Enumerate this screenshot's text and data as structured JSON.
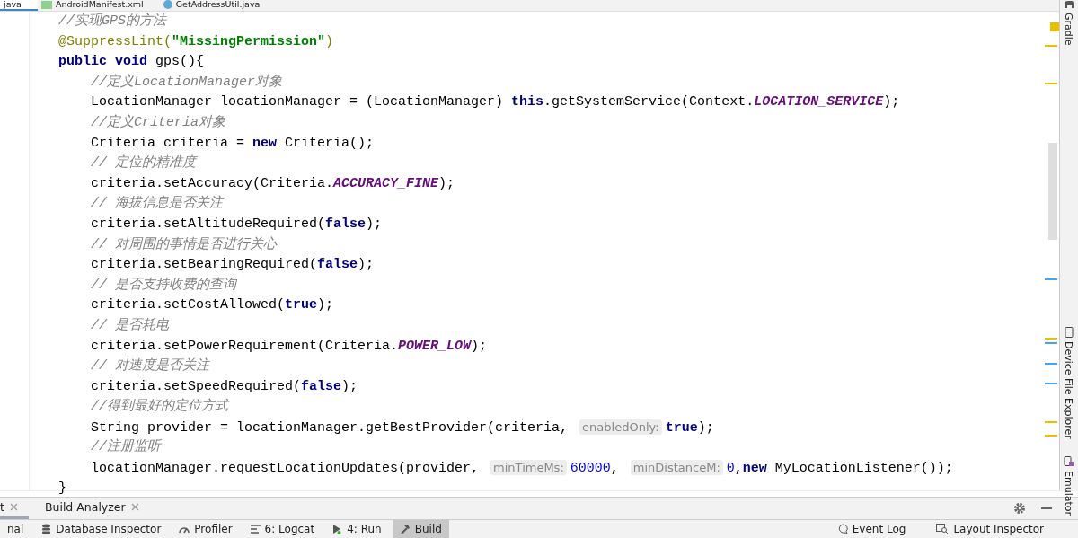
{
  "editor_tabs": [
    {
      "label": "java",
      "selected": true
    },
    {
      "label": "AndroidManifest.xml",
      "selected": false
    },
    {
      "label": "GetAddressUtil.java",
      "selected": false
    }
  ],
  "code_lines": [
    {
      "indented": false,
      "tokens": [
        {
          "kind": "comment",
          "text": "//实现GPS的方法"
        }
      ]
    },
    {
      "indented": false,
      "tokens": [
        {
          "kind": "annotation",
          "text": "@SuppressLint("
        },
        {
          "kind": "string",
          "text": "\"MissingPermission\""
        },
        {
          "kind": "annotation",
          "text": ")"
        }
      ]
    },
    {
      "indented": false,
      "tokens": [
        {
          "kind": "keyword",
          "text": "public void"
        },
        {
          "kind": "plain",
          "text": " gps(){"
        }
      ]
    },
    {
      "indented": true,
      "tokens": [
        {
          "kind": "comment",
          "text": "//定义LocationManager对象"
        }
      ]
    },
    {
      "indented": true,
      "tokens": [
        {
          "kind": "plain",
          "text": "LocationManager locationManager = (LocationManager) "
        },
        {
          "kind": "keyword",
          "text": "this"
        },
        {
          "kind": "plain",
          "text": ".getSystemService(Context."
        },
        {
          "kind": "constant",
          "text": "LOCATION_SERVICE"
        },
        {
          "kind": "plain",
          "text": ");"
        }
      ]
    },
    {
      "indented": true,
      "tokens": [
        {
          "kind": "comment",
          "text": "//定义Criteria对象"
        }
      ]
    },
    {
      "indented": true,
      "tokens": [
        {
          "kind": "plain",
          "text": "Criteria criteria = "
        },
        {
          "kind": "keyword",
          "text": "new"
        },
        {
          "kind": "plain",
          "text": " Criteria();"
        }
      ]
    },
    {
      "indented": true,
      "tokens": [
        {
          "kind": "comment",
          "text": "// 定位的精准度"
        }
      ]
    },
    {
      "indented": true,
      "tokens": [
        {
          "kind": "plain",
          "text": "criteria.setAccuracy(Criteria."
        },
        {
          "kind": "constant",
          "text": "ACCURACY_FINE"
        },
        {
          "kind": "plain",
          "text": ");"
        }
      ]
    },
    {
      "indented": true,
      "tokens": [
        {
          "kind": "comment",
          "text": "// 海拔信息是否关注"
        }
      ]
    },
    {
      "indented": true,
      "tokens": [
        {
          "kind": "plain",
          "text": "criteria.setAltitudeRequired("
        },
        {
          "kind": "keyword",
          "text": "false"
        },
        {
          "kind": "plain",
          "text": ");"
        }
      ]
    },
    {
      "indented": true,
      "tokens": [
        {
          "kind": "comment",
          "text": "// 对周围的事情是否进行关心"
        }
      ]
    },
    {
      "indented": true,
      "tokens": [
        {
          "kind": "plain",
          "text": "criteria.setBearingRequired("
        },
        {
          "kind": "keyword",
          "text": "false"
        },
        {
          "kind": "plain",
          "text": ");"
        }
      ]
    },
    {
      "indented": true,
      "tokens": [
        {
          "kind": "comment",
          "text": "// 是否支持收费的查询"
        }
      ]
    },
    {
      "indented": true,
      "tokens": [
        {
          "kind": "plain",
          "text": "criteria.setCostAllowed("
        },
        {
          "kind": "keyword",
          "text": "true"
        },
        {
          "kind": "plain",
          "text": ");"
        }
      ]
    },
    {
      "indented": true,
      "tokens": [
        {
          "kind": "comment",
          "text": "// 是否耗电"
        }
      ]
    },
    {
      "indented": true,
      "tokens": [
        {
          "kind": "plain",
          "text": "criteria.setPowerRequirement(Criteria."
        },
        {
          "kind": "constant",
          "text": "POWER_LOW"
        },
        {
          "kind": "plain",
          "text": ");"
        }
      ]
    },
    {
      "indented": true,
      "tokens": [
        {
          "kind": "comment",
          "text": "// 对速度是否关注"
        }
      ]
    },
    {
      "indented": true,
      "tokens": [
        {
          "kind": "plain",
          "text": "criteria.setSpeedRequired("
        },
        {
          "kind": "keyword",
          "text": "false"
        },
        {
          "kind": "plain",
          "text": ");"
        }
      ]
    },
    {
      "indented": true,
      "tokens": [
        {
          "kind": "comment",
          "text": "//得到最好的定位方式"
        }
      ]
    },
    {
      "indented": true,
      "tokens": [
        {
          "kind": "plain",
          "text": "String provider = locationManager.getBestProvider(criteria, "
        },
        {
          "kind": "hint",
          "text": "enabledOnly:"
        },
        {
          "kind": "keyword",
          "text": "true"
        },
        {
          "kind": "plain",
          "text": ");"
        }
      ]
    },
    {
      "indented": true,
      "tokens": [
        {
          "kind": "comment",
          "text": "//注册监听"
        }
      ]
    },
    {
      "indented": true,
      "tokens": [
        {
          "kind": "plain",
          "text": "locationManager.requestLocationUpdates(provider, "
        },
        {
          "kind": "hint",
          "text": "minTimeMs:"
        },
        {
          "kind": "number",
          "text": "60000"
        },
        {
          "kind": "plain",
          "text": ", "
        },
        {
          "kind": "hint",
          "text": "minDistanceM:"
        },
        {
          "kind": "number",
          "text": "0"
        },
        {
          "kind": "plain",
          "text": ","
        },
        {
          "kind": "keyword",
          "text": "new"
        },
        {
          "kind": "plain",
          "text": " MyLocationListener());"
        }
      ]
    },
    {
      "indented": false,
      "tokens": [
        {
          "kind": "plain",
          "text": "}"
        }
      ]
    }
  ],
  "right_sidebar": [
    {
      "label": "Gradle"
    },
    {
      "label": "Device File Explorer"
    },
    {
      "label": "Emulator"
    }
  ],
  "tool_tabs": [
    {
      "label": "t",
      "selected": true
    },
    {
      "label": "Build Analyzer",
      "selected": false
    }
  ],
  "bottom_tools": [
    {
      "label": "nal",
      "selected": false
    },
    {
      "label": "Database Inspector",
      "selected": false
    },
    {
      "label": "Profiler",
      "selected": false
    },
    {
      "label": "6: Logcat",
      "selected": false
    },
    {
      "label": "4: Run",
      "selected": false
    },
    {
      "label": "Build",
      "selected": true
    }
  ],
  "bottom_tools_right": [
    {
      "label": "Event Log"
    },
    {
      "label": "Layout Inspector"
    }
  ]
}
